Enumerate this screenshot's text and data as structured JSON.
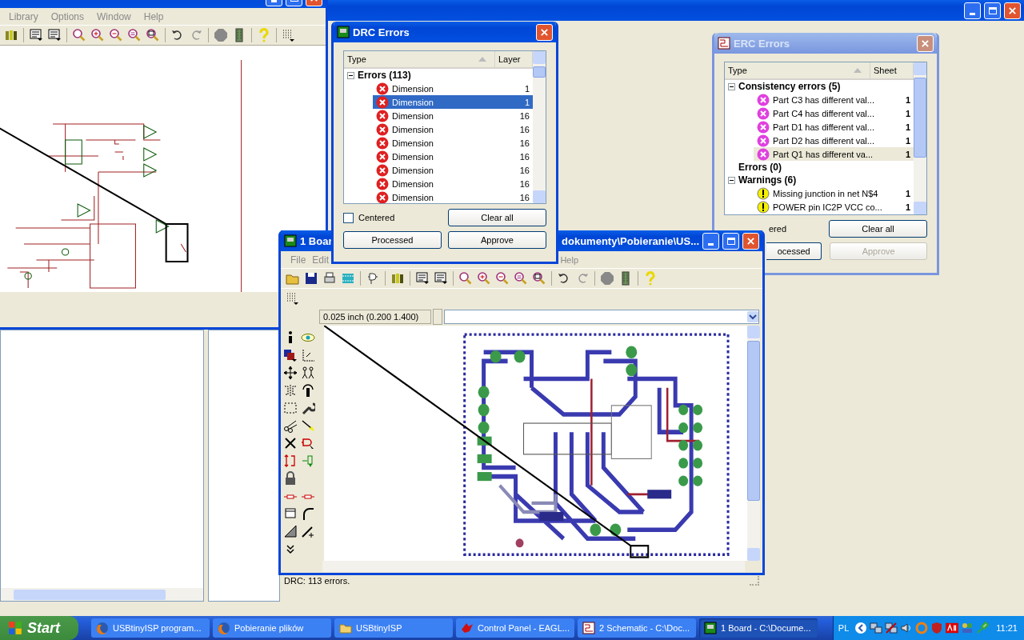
{
  "background_window": {
    "active": true
  },
  "schematic_window": {
    "menu": [
      "Library",
      "Options",
      "Window",
      "Help"
    ]
  },
  "drc_dialog": {
    "title": "DRC Errors",
    "active": true,
    "columns": [
      "Type",
      "Layer"
    ],
    "group": {
      "label": "Errors (113)",
      "expanded": true
    },
    "rows": [
      {
        "type": "Dimension",
        "layer": "1",
        "selected": false
      },
      {
        "type": "Dimension",
        "layer": "1",
        "selected": true
      },
      {
        "type": "Dimension",
        "layer": "16",
        "selected": false
      },
      {
        "type": "Dimension",
        "layer": "16",
        "selected": false
      },
      {
        "type": "Dimension",
        "layer": "16",
        "selected": false
      },
      {
        "type": "Dimension",
        "layer": "16",
        "selected": false
      },
      {
        "type": "Dimension",
        "layer": "16",
        "selected": false
      },
      {
        "type": "Dimension",
        "layer": "16",
        "selected": false
      },
      {
        "type": "Dimension",
        "layer": "16",
        "selected": false
      }
    ],
    "centered": {
      "label": "Centered",
      "checked": false
    },
    "buttons": [
      {
        "label": "Clear all",
        "disabled": false
      },
      {
        "label": "Processed",
        "disabled": false
      },
      {
        "label": "Approve",
        "disabled": false
      }
    ]
  },
  "erc_dialog": {
    "title": "ERC Errors",
    "active": false,
    "columns": [
      "Type",
      "Sheet"
    ],
    "groups": [
      {
        "label": "Consistency errors (5)",
        "expanded": true,
        "children": [
          {
            "kind": "error",
            "text": "Part C3 has different val...",
            "sheet": "1",
            "selected": false
          },
          {
            "kind": "error",
            "text": "Part C4 has different val...",
            "sheet": "1",
            "selected": false
          },
          {
            "kind": "error",
            "text": "Part D1 has different val...",
            "sheet": "1",
            "selected": false
          },
          {
            "kind": "error",
            "text": "Part D2 has different val...",
            "sheet": "1",
            "selected": false
          },
          {
            "kind": "error",
            "text": "Part Q1 has different va...",
            "sheet": "1",
            "selected": true
          }
        ]
      },
      {
        "label": "Errors (0)"
      },
      {
        "label": "Warnings (6)",
        "expanded": true,
        "children": [
          {
            "kind": "warning",
            "text": "Missing junction in net N$4",
            "sheet": "1",
            "selected": false
          },
          {
            "kind": "warning",
            "text": "POWER pin IC2P VCC co...",
            "sheet": "1",
            "selected": false
          }
        ]
      }
    ],
    "centered": {
      "label": "ered"
    },
    "buttons": [
      {
        "label": "Clear all",
        "disabled": false
      },
      {
        "label": "ocessed",
        "disabled": false
      },
      {
        "label": "Approve",
        "disabled": true
      }
    ]
  },
  "board_window": {
    "title_start": "1 Boar",
    "title_end": "dokumenty\\Pobieranie\\US...",
    "active": true,
    "menu": [
      "File",
      "Edit",
      "Help"
    ],
    "coordinate": "0.025 inch (0.200 1.400)",
    "status": "DRC: 113 errors."
  },
  "taskbar": {
    "start": "Start",
    "tasks": [
      {
        "label": "USBtinyISP program...",
        "kind": "browser",
        "selected": false
      },
      {
        "label": "Pobieranie plików",
        "kind": "browser",
        "selected": false
      },
      {
        "label": "USBtinyISP",
        "kind": "folder",
        "selected": false
      },
      {
        "label": "Control Panel - EAGL...",
        "kind": "eagle",
        "selected": false
      },
      {
        "label": "2 Schematic - C:\\Doc...",
        "kind": "schematic",
        "selected": false
      },
      {
        "label": "1 Board - C:\\Docume...",
        "kind": "board",
        "selected": true
      }
    ],
    "language": "PL",
    "clock": "11:21"
  }
}
